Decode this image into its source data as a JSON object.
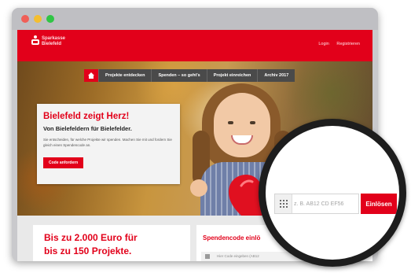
{
  "colors": {
    "brand_red": "#e2001a",
    "nav_gray": "#4a4a4a",
    "window_frame": "#c9c9cc",
    "magnifier_ring": "#1d1d1d"
  },
  "window": {
    "controls": [
      "close-icon",
      "minimize-icon",
      "maximize-icon"
    ]
  },
  "header": {
    "logo_line1": "Sparkasse",
    "logo_line2": "Bielefeld",
    "login": "Login",
    "register": "Registrieren"
  },
  "nav": {
    "home_icon": "home-icon",
    "items": [
      {
        "label": "Projekte entdecken"
      },
      {
        "label": "Spenden – so geht's"
      },
      {
        "label": "Projekt einreichen"
      },
      {
        "label": "Archiv 2017"
      }
    ]
  },
  "hero": {
    "title": "Bielefeld zeigt Herz!",
    "subtitle": "Von Bielefeldern für Bielefelder.",
    "text": "Sie entscheiden, für welche Projekte wir spenden. Machen Sie mit und fordern Sie gleich einen Spendencode an.",
    "button": "Code anfordern"
  },
  "promo": {
    "line1": "Bis zu 2.000 Euro für",
    "line2": "bis zu 150 Projekte."
  },
  "code_section": {
    "title": "Spendencode einlö",
    "placeholder": "Hier Code eingeben (AB12"
  },
  "magnifier": {
    "placeholder": "z. B. AB12 CD EF56",
    "button": "Einlösen",
    "icon": "keypad-icon"
  }
}
